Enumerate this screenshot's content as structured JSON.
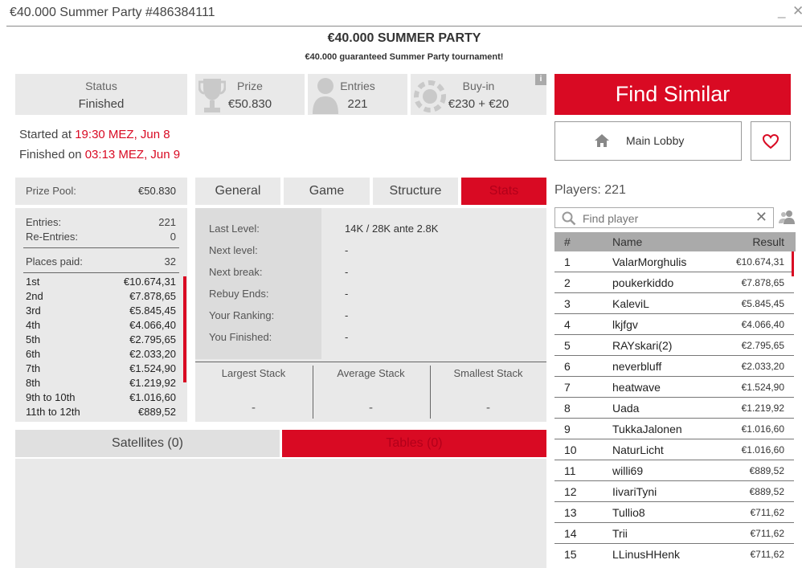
{
  "window": {
    "title": "€40.000 Summer Party #486384111",
    "minimize": "_",
    "close": "✕"
  },
  "tournament": {
    "name": "€40.000 SUMMER PARTY",
    "subtitle": "€40.000 guaranteed Summer Party tournament!"
  },
  "summary": {
    "status_label": "Status",
    "status_value": "Finished",
    "prize_label": "Prize",
    "prize_value": "€50.830",
    "entries_label": "Entries",
    "entries_value": "221",
    "buyin_label": "Buy-in",
    "buyin_value": "€230 + €20",
    "info": "i"
  },
  "actions": {
    "find_similar": "Find Similar",
    "main_lobby": "Main Lobby"
  },
  "times": {
    "started_prefix": "Started at ",
    "started_value": "19:30 MEZ, Jun 8",
    "finished_prefix": "Finished on ",
    "finished_value": "03:13 MEZ, Jun 9"
  },
  "prize_pool": {
    "label": "Prize Pool:",
    "value": "€50.830",
    "entries_label": "Entries:",
    "entries_value": "221",
    "reentries_label": "Re-Entries:",
    "reentries_value": "0",
    "places_label": "Places paid:",
    "places_value": "32",
    "payouts": [
      {
        "place": "1st",
        "amount": "€10.674,31"
      },
      {
        "place": "2nd",
        "amount": "€7.878,65"
      },
      {
        "place": "3rd",
        "amount": "€5.845,45"
      },
      {
        "place": "4th",
        "amount": "€4.066,40"
      },
      {
        "place": "5th",
        "amount": "€2.795,65"
      },
      {
        "place": "6th",
        "amount": "€2.033,20"
      },
      {
        "place": "7th",
        "amount": "€1.524,90"
      },
      {
        "place": "8th",
        "amount": "€1.219,92"
      },
      {
        "place": "9th to 10th",
        "amount": "€1.016,60"
      },
      {
        "place": "11th to 12th",
        "amount": "€889,52"
      }
    ]
  },
  "tabs": [
    "General",
    "Game",
    "Structure",
    "Stats"
  ],
  "stats": {
    "rows": [
      {
        "label": "Last Level:",
        "value": "14K / 28K ante 2.8K"
      },
      {
        "label": "Next level:",
        "value": "-"
      },
      {
        "label": "Next break:",
        "value": "-"
      },
      {
        "label": "Rebuy Ends:",
        "value": "-"
      },
      {
        "label": "Your Ranking:",
        "value": "-"
      },
      {
        "label": "You Finished:",
        "value": "-"
      }
    ],
    "largest_label": "Largest Stack",
    "largest_value": "-",
    "average_label": "Average Stack",
    "average_value": "-",
    "smallest_label": "Smallest Stack",
    "smallest_value": "-"
  },
  "bottom_tabs": {
    "satellites": "Satellites (0)",
    "tables": "Tables (0)"
  },
  "players": {
    "count_label": "Players: 221",
    "search_placeholder": "Find player",
    "clear": "✕",
    "columns": {
      "rank": "#",
      "name": "Name",
      "result": "Result"
    },
    "rows": [
      {
        "rank": "1",
        "name": "ValarMorghulis",
        "result": "€10.674,31"
      },
      {
        "rank": "2",
        "name": "poukerkiddo",
        "result": "€7.878,65"
      },
      {
        "rank": "3",
        "name": "KaleviL",
        "result": "€5.845,45"
      },
      {
        "rank": "4",
        "name": "lkjfgv",
        "result": "€4.066,40"
      },
      {
        "rank": "5",
        "name": "RAYskari(2)",
        "result": "€2.795,65"
      },
      {
        "rank": "6",
        "name": "neverbluff",
        "result": "€2.033,20"
      },
      {
        "rank": "7",
        "name": "heatwave",
        "result": "€1.524,90"
      },
      {
        "rank": "8",
        "name": "Uada",
        "result": "€1.219,92"
      },
      {
        "rank": "9",
        "name": "TukkaJalonen",
        "result": "€1.016,60"
      },
      {
        "rank": "10",
        "name": "NaturLicht",
        "result": "€1.016,60"
      },
      {
        "rank": "11",
        "name": "willi69",
        "result": "€889,52"
      },
      {
        "rank": "12",
        "name": "IivariTyni",
        "result": "€889,52"
      },
      {
        "rank": "13",
        "name": "Tullio8",
        "result": "€711,62"
      },
      {
        "rank": "14",
        "name": "Trii",
        "result": "€711,62"
      },
      {
        "rank": "15",
        "name": "LLinusHHenk",
        "result": "€711,62"
      }
    ]
  },
  "colors": {
    "accent": "#d90a23",
    "panel": "#e9e9e9"
  }
}
